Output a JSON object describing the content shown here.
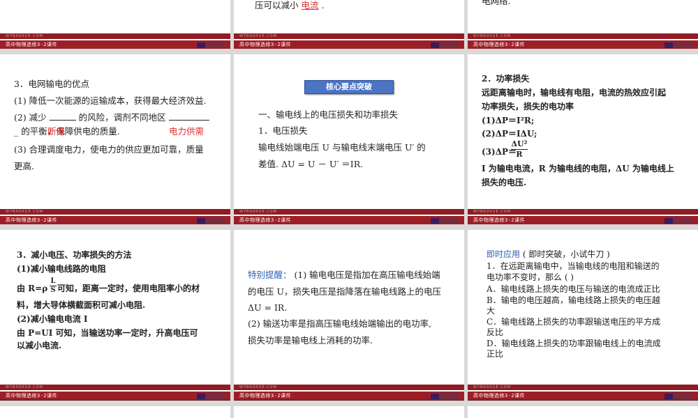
{
  "bar_title": "高中物理选修3-2课件",
  "bar_watermark": "WYBAOXUE.COM",
  "slide_r0c1": {
    "text": "压可以减小",
    "answer": "电流",
    "end": "."
  },
  "slide_r0c2": {
    "text": "电网络."
  },
  "slide_r1c0": {
    "title": "3．电网输电的优点",
    "p1": "(1) 降低一次能源的运输成本，获得最大经济效益.",
    "p2a": "(2) 减少",
    "p2b": "的风险，调剂不同地区",
    "p2c": "_ 的平衡，保障供电的质量.",
    "ans1": "断电",
    "ans2": "电力供需",
    "p3a": "(3) 合理调度电力，使电力的供应更加可靠，质量",
    "p3b": "更高."
  },
  "slide_r1c1": {
    "button": "核心要点突破",
    "h1": "一、输电线上的电压损失和功率损失",
    "h2": "1．电压损失",
    "l1": "输电线始端电压 U 与输电线末端电压 U′  的",
    "l2": "差值.  ΔU = U － U′  ＝IR."
  },
  "slide_r1c2": {
    "h": "2．功率损失",
    "l1": "远距离输电时，输电线有电阻，电流的热效应引起",
    "l2": "功率损失，损失的电功率",
    "f1": "(1)ΔP＝I²R;",
    "f2": "(2)ΔP＝IΔU;",
    "f3a": "(3)ΔP＝",
    "f3num": "ΔU²",
    "f3den": "R",
    "l3": "I 为输电电流，R 为输电线的电阻，ΔU 为输电线上",
    "l4": "损失的电压."
  },
  "slide_r2c0": {
    "h": "3．减小电压、功率损失的方法",
    "s1": "(1)减小输电线路的电阻",
    "l1a": "由  R=ρ",
    "l1num": "L",
    "l1den": "S",
    "l1b": "可知，距离一定时，使用电阻率小的材",
    "l2": "料，增大导体横截面积可减小电阻.",
    "s2": "(2)减小输电电流 I",
    "l3": "由  P=UI  可知，当输送功率一定时，升高电压可",
    "l4": "以减小电流."
  },
  "slide_r2c1": {
    "tip": "特别提醒：",
    "l1": "(1) 输电电压是指加在高压输电线始端",
    "l2": "的电压 U，损失电压是指降落在输电线路上的电压",
    "l3": "ΔU = IR.",
    "l4": "(2) 输送功率是指高压输电线始端输出的电功率,",
    "l5": "损失功率是输电线上消耗的功率."
  },
  "slide_r2c2": {
    "head": "即时应用",
    "head2": "( 即时突破，小试牛刀 )",
    "q1": "1．在远距离输电中，当输电线的电阻和输送的",
    "q2": "电功率不变时，那么 (          )",
    "a1": "A．输电线路上损失的电压与输送的电流成正比",
    "b1": "B．输电的电压越高，输电线路上损失的电压越",
    "b2": "大",
    "c1": "C．输电线路上损失的功率跟输送电压的平方成",
    "c2": "反比",
    "d1": "D．输电线路上损失的功率跟输电线上的电流成",
    "d2": "正比"
  },
  "colors": {
    "bar": "#9d1f26",
    "answer": "#e03030",
    "blue": "#2a5fb0",
    "button": "#4a74c4"
  }
}
